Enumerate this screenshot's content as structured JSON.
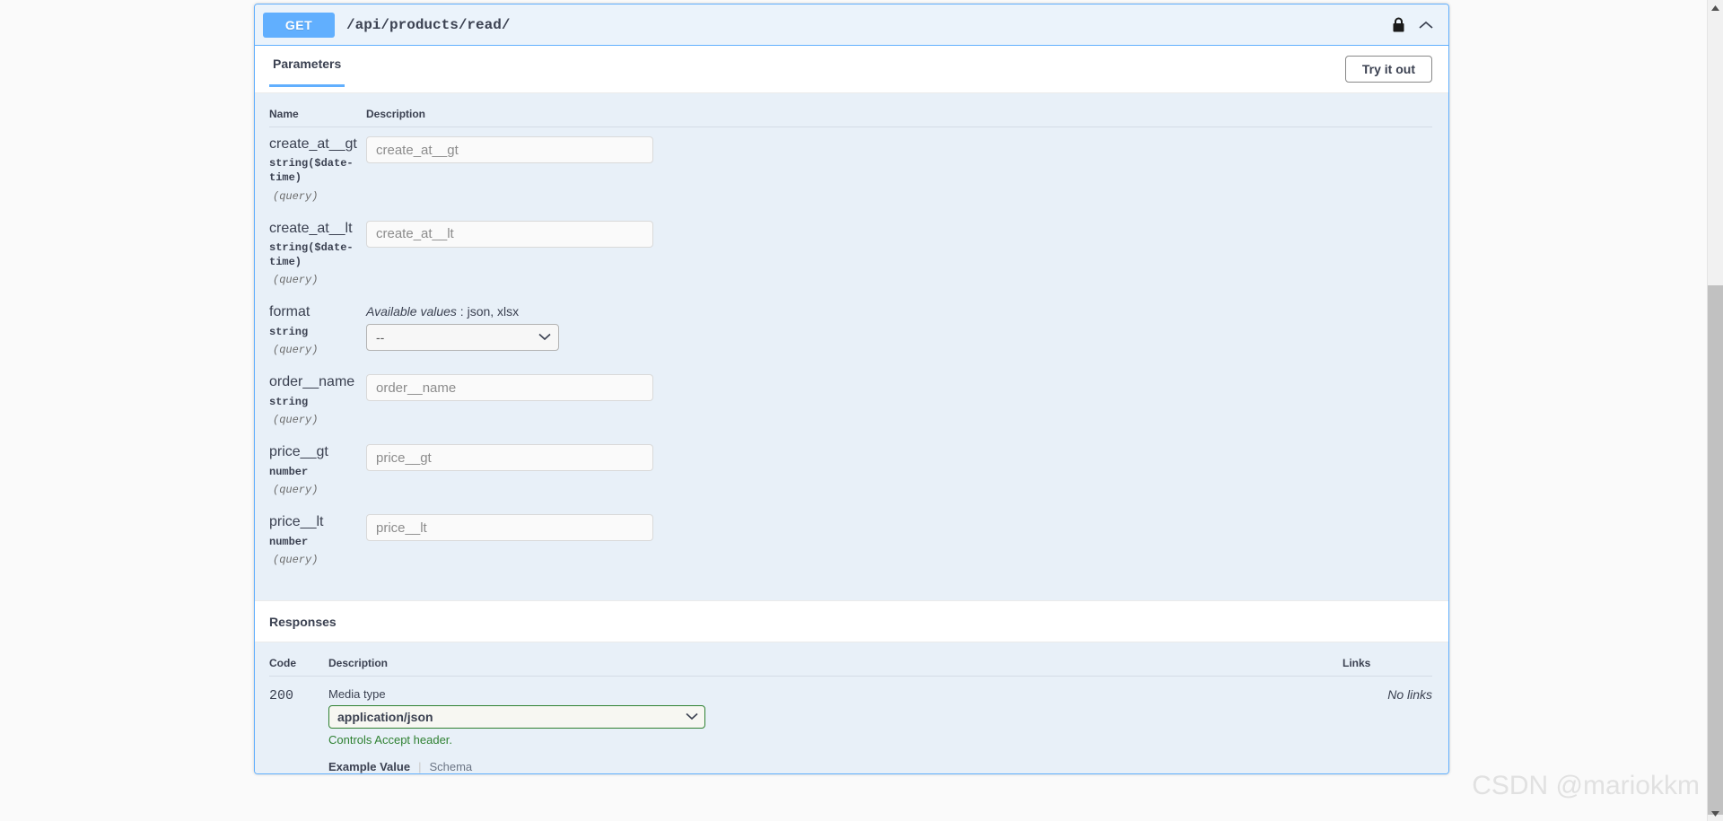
{
  "operation": {
    "method": "GET",
    "path": "/api/products/read/",
    "lock_icon": "lock-icon",
    "collapse_icon": "chevron-up-icon"
  },
  "tabs": [
    {
      "label": "Parameters",
      "active": true
    }
  ],
  "try_it_out": {
    "label": "Try it out"
  },
  "parameters": {
    "headers": {
      "name": "Name",
      "description": "Description"
    },
    "rows": [
      {
        "name": "create_at__gt",
        "type": "string($date-time)",
        "in": "(query)",
        "control": "input",
        "placeholder": "create_at__gt"
      },
      {
        "name": "create_at__lt",
        "type": "string($date-time)",
        "in": "(query)",
        "control": "input",
        "placeholder": "create_at__lt"
      },
      {
        "name": "format",
        "type": "string",
        "in": "(query)",
        "control": "select",
        "available_values_label": "Available values",
        "available_values": "json, xlsx",
        "selected": "--",
        "options": [
          "--",
          "json",
          "xlsx"
        ]
      },
      {
        "name": "order__name",
        "type": "string",
        "in": "(query)",
        "control": "input",
        "placeholder": "order__name"
      },
      {
        "name": "price__gt",
        "type": "number",
        "in": "(query)",
        "control": "input",
        "placeholder": "price__gt"
      },
      {
        "name": "price__lt",
        "type": "number",
        "in": "(query)",
        "control": "input",
        "placeholder": "price__lt"
      }
    ]
  },
  "responses": {
    "title": "Responses",
    "headers": {
      "code": "Code",
      "description": "Description",
      "links": "Links"
    },
    "rows": [
      {
        "code": "200",
        "media_type_label": "Media type",
        "media_type_selected": "application/json",
        "media_type_options": [
          "application/json"
        ],
        "controls_accept": "Controls Accept header.",
        "example_tab": "Example Value",
        "schema_tab": "Schema",
        "links": "No links"
      }
    ]
  },
  "watermark": {
    "text": "CSDN @mariokkm"
  },
  "colors": {
    "method_get": "#61affe",
    "panel_border": "#61affe",
    "panel_body": "#e8f0f8",
    "header_bg": "#ebf3fb",
    "text": "#3b4151",
    "green_accent": "#2f8132",
    "page_bg": "#fafafa"
  }
}
